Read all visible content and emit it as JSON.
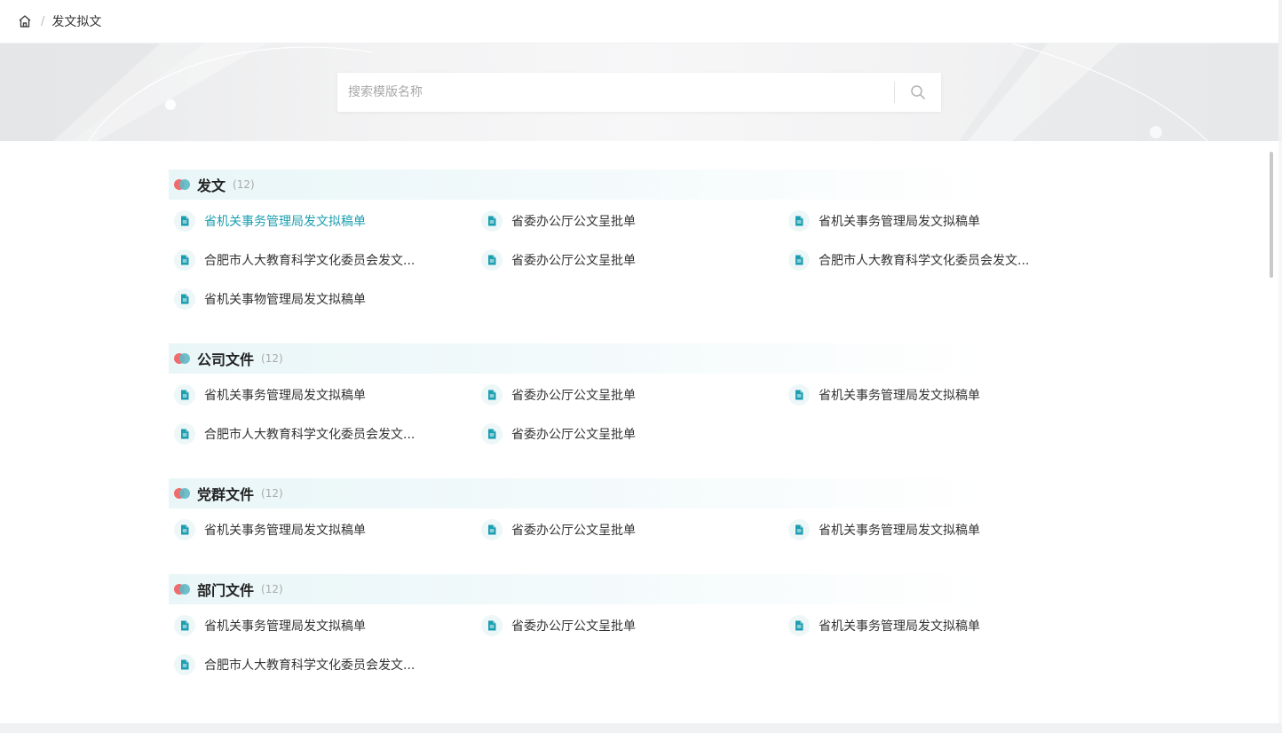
{
  "breadcrumb": {
    "current": "发文拟文",
    "separator": "/"
  },
  "search": {
    "placeholder": "搜索模版名称",
    "value": ""
  },
  "colors": {
    "accent": "#1b9eb0",
    "dot_red": "#f06b6b",
    "dot_teal": "#5fb9c6"
  },
  "sections": [
    {
      "title": "发文",
      "count": "(12)",
      "items": [
        {
          "label": "省机关事务管理局发文拟稿单",
          "active": true
        },
        {
          "label": "省委办公厅公文呈批单"
        },
        {
          "label": "省机关事务管理局发文拟稿单"
        },
        {
          "label": "合肥市人大教育科学文化委员会发文..."
        },
        {
          "label": "省委办公厅公文呈批单"
        },
        {
          "label": "合肥市人大教育科学文化委员会发文..."
        },
        {
          "label": "省机关事物管理局发文拟稿单"
        }
      ]
    },
    {
      "title": "公司文件",
      "count": "(12)",
      "items": [
        {
          "label": "省机关事务管理局发文拟稿单"
        },
        {
          "label": "省委办公厅公文呈批单"
        },
        {
          "label": "省机关事务管理局发文拟稿单"
        },
        {
          "label": "合肥市人大教育科学文化委员会发文..."
        },
        {
          "label": "省委办公厅公文呈批单"
        }
      ]
    },
    {
      "title": "党群文件",
      "count": "(12)",
      "items": [
        {
          "label": "省机关事务管理局发文拟稿单"
        },
        {
          "label": "省委办公厅公文呈批单"
        },
        {
          "label": "省机关事务管理局发文拟稿单"
        }
      ]
    },
    {
      "title": "部门文件",
      "count": "(12)",
      "items": [
        {
          "label": "省机关事务管理局发文拟稿单"
        },
        {
          "label": "省委办公厅公文呈批单"
        },
        {
          "label": "省机关事务管理局发文拟稿单"
        },
        {
          "label": "合肥市人大教育科学文化委员会发文..."
        }
      ]
    }
  ]
}
